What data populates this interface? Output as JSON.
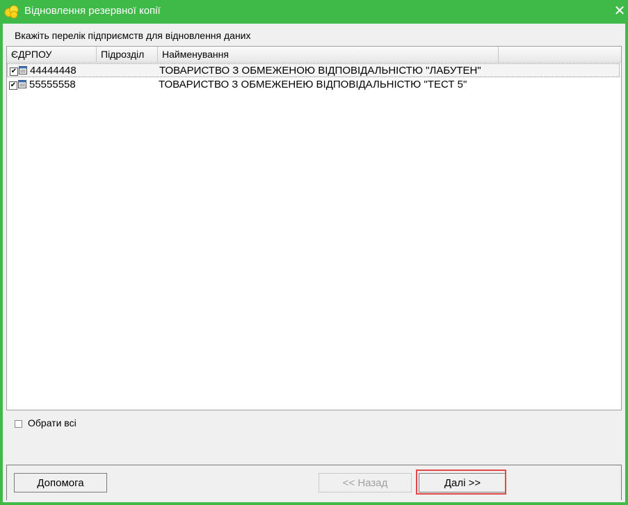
{
  "window": {
    "title": "Відновлення резервної копії"
  },
  "instruction": "Вкажіть перелік підприємств для відновлення даних",
  "table": {
    "columns": [
      "ЄДРПОУ",
      "Підрозділ",
      "Найменування"
    ],
    "rows": [
      {
        "code": "44444448",
        "division": "",
        "name": "ТОВАРИСТВО З ОБМЕЖЕНОЮ ВІДПОВІДАЛЬНІСТЮ \"ЛАБУТЕН\"",
        "checked": true
      },
      {
        "code": "55555558",
        "division": "",
        "name": "ТОВАРИСТВО З ОБМЕЖЕНЕЮ ВІДПОВІДАЛЬНІСТЮ \"ТЕСТ 5\"",
        "checked": true
      }
    ]
  },
  "select_all_label": "Обрати всі",
  "buttons": {
    "help": "Допомога",
    "back": "<< Назад",
    "next": "Далі >>"
  },
  "icons": {
    "app": "app-flower-icon",
    "close": "close-icon",
    "row": "company-icon"
  },
  "colors": {
    "frame": "#3fb948",
    "highlight": "#e04848"
  }
}
